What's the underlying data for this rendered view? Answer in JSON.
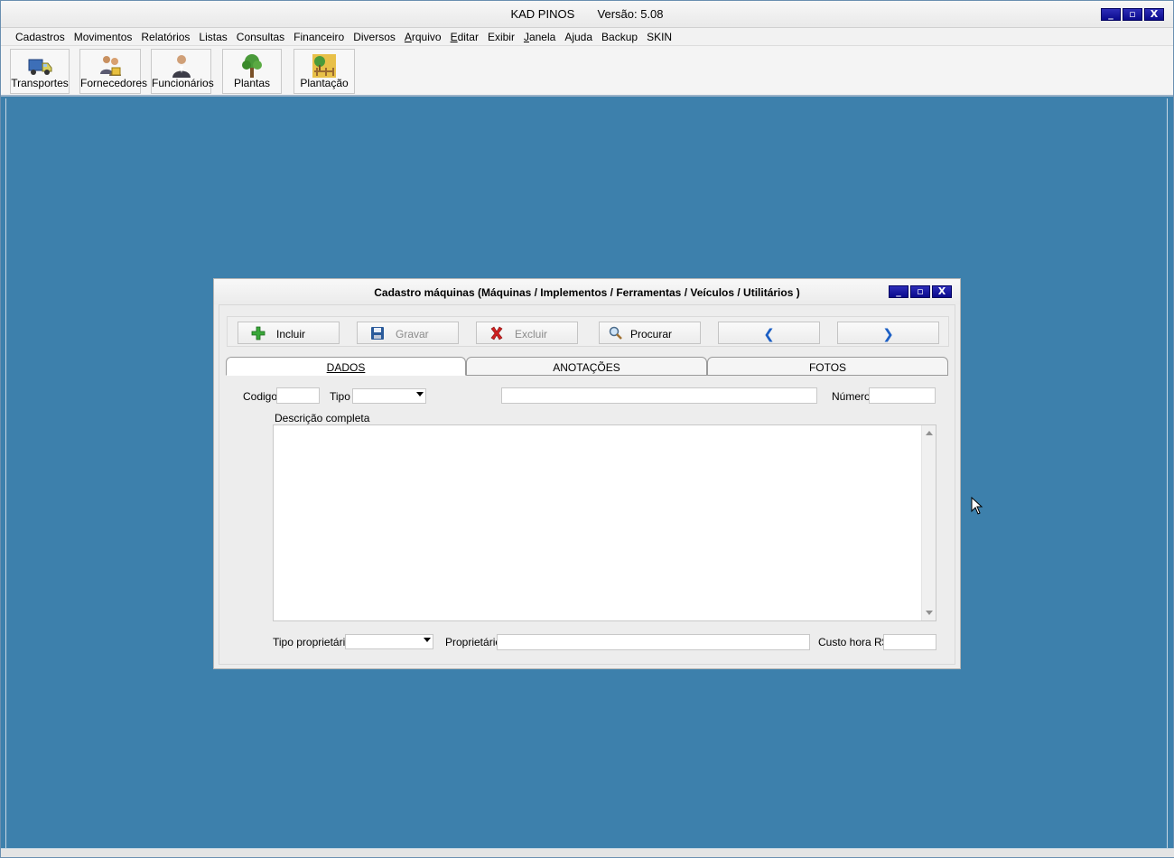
{
  "app": {
    "title": "KAD PINOS",
    "version": "Versão: 5.08"
  },
  "window_controls": {
    "minimize": "_",
    "maximize": "▫",
    "close": "X"
  },
  "menu": [
    "Cadastros",
    "Movimentos",
    "Relatórios",
    "Listas",
    "Consultas",
    "Financeiro",
    "Diversos",
    "Arquivo",
    "Editar",
    "Exibir",
    "Janela",
    "Ajuda",
    "Backup",
    "SKIN"
  ],
  "toolbar": {
    "transportes": "Transportes",
    "fornecedores": "Fornecedores",
    "funcionarios": "Funcionários",
    "plantas": "Plantas",
    "plantacao": "Plantação"
  },
  "dialog": {
    "title": "Cadastro máquinas (Máquinas / Implementos / Ferramentas / Veículos / Utilitários )",
    "buttons": {
      "incluir": "Incluir",
      "gravar": "Gravar",
      "excluir": "Excluir",
      "procurar": "Procurar",
      "prev": "❮",
      "next": "❯"
    },
    "tabs": {
      "dados": "DADOS",
      "anotacoes": "ANOTAÇÕES",
      "fotos": "FOTOS"
    },
    "fields": {
      "codigo_label": "Codigo",
      "codigo_value": "",
      "tipo_label": "Tipo",
      "tipo_value": "",
      "descricao_value": "",
      "numero_label": "Número",
      "numero_value": "",
      "descricao_completa_label": "Descrição completa",
      "descricao_completa_value": "",
      "tipo_proprietario_label": "Tipo proprietário",
      "tipo_proprietario_value": "",
      "proprietario_label": "Proprietário",
      "proprietario_value": "",
      "custo_hora_label": "Custo hora R$",
      "custo_hora_value": ""
    }
  },
  "colors": {
    "desktop": "#3d80ac",
    "title_button": "#0a0a8c",
    "dialog_bg": "#ededed"
  }
}
